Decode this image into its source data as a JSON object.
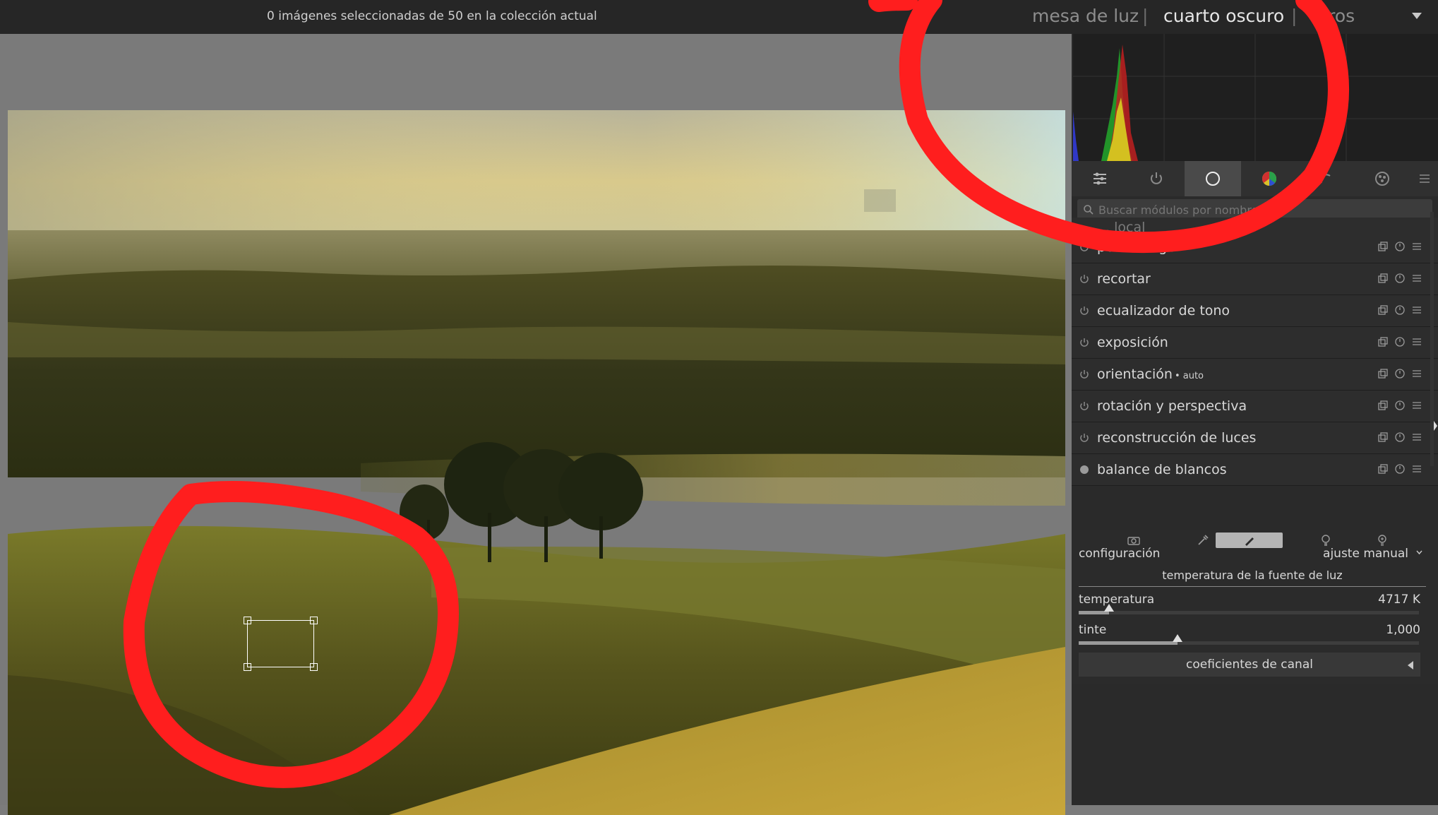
{
  "header": {
    "selection_status": "0 imágenes seleccionadas de 50 en la colección actual",
    "views": {
      "lighttable": "mesa de luz",
      "separator": "|",
      "darkroom": "cuarto oscuro",
      "other": "otros"
    }
  },
  "search": {
    "placeholder": "Buscar módulos por nombre o et"
  },
  "modules": {
    "partial_top": "... local",
    "items": [
      {
        "name": "película rgb"
      },
      {
        "name": "recortar"
      },
      {
        "name": "ecualizador de tono"
      },
      {
        "name": "exposición"
      },
      {
        "name": "orientación",
        "tag": "• auto"
      },
      {
        "name": "rotación y perspectiva"
      },
      {
        "name": "reconstrucción de luces"
      },
      {
        "name": "balance de blancos"
      }
    ]
  },
  "white_balance": {
    "settings_label": "configuración",
    "settings_value": "ajuste manual",
    "section_title": "temperatura de la fuente de luz",
    "temperature": {
      "label": "temperatura",
      "value": "4717 K",
      "fraction": 0.09
    },
    "tint": {
      "label": "tinte",
      "value": "1,000",
      "fraction": 0.29
    },
    "coefficients_label": "coeficientes de canal"
  },
  "colors": {
    "annotation_red": "#ff1e1e",
    "active_tab": "#4a4a4a",
    "panel_bg": "#2a2a2a"
  }
}
